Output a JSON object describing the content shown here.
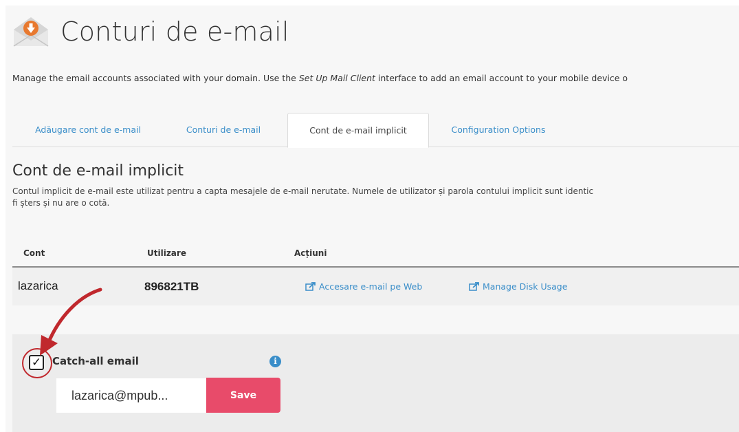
{
  "header": {
    "title": "Conturi de e-mail",
    "icon": "mail-envelope-icon"
  },
  "intro": {
    "before": "Manage the email accounts associated with your domain. Use the ",
    "emphasis": "Set Up Mail Client",
    "after": " interface to add an email account to your mobile device o"
  },
  "tabs": [
    {
      "label": "Adăugare cont de e-mail"
    },
    {
      "label": "Conturi de e-mail"
    },
    {
      "label": "Cont de e-mail implicit",
      "active": true
    },
    {
      "label": "Configuration Options"
    }
  ],
  "section": {
    "title": "Cont de e-mail implicit",
    "desc_line1": "Contul implicit de e-mail este utilizat pentru a capta mesajele de e-mail nerutate. Numele de utilizator și parola contului implicit sunt identic",
    "desc_line2": "fi șters și nu are o cotă."
  },
  "table": {
    "headers": [
      "Cont",
      "Utilizare",
      "Acțiuni"
    ],
    "row": {
      "account": "lazarica",
      "usage_number": "896821",
      "usage_unit": "TB",
      "actions": [
        {
          "label": "Accesare e-mail pe Web",
          "icon": "external-link-icon"
        },
        {
          "label": "Manage Disk Usage",
          "icon": "external-link-icon"
        }
      ]
    }
  },
  "catchall": {
    "label": "Catch-all email",
    "checked": true,
    "check_glyph": "✓",
    "info_glyph": "i",
    "input_value": "lazarica@mpub...",
    "save_label": "Save"
  },
  "colors": {
    "link": "#3a8ec9",
    "save_button": "#e84b6a",
    "annotation_red": "#c0282d",
    "header_icon_orange": "#e8792f"
  }
}
